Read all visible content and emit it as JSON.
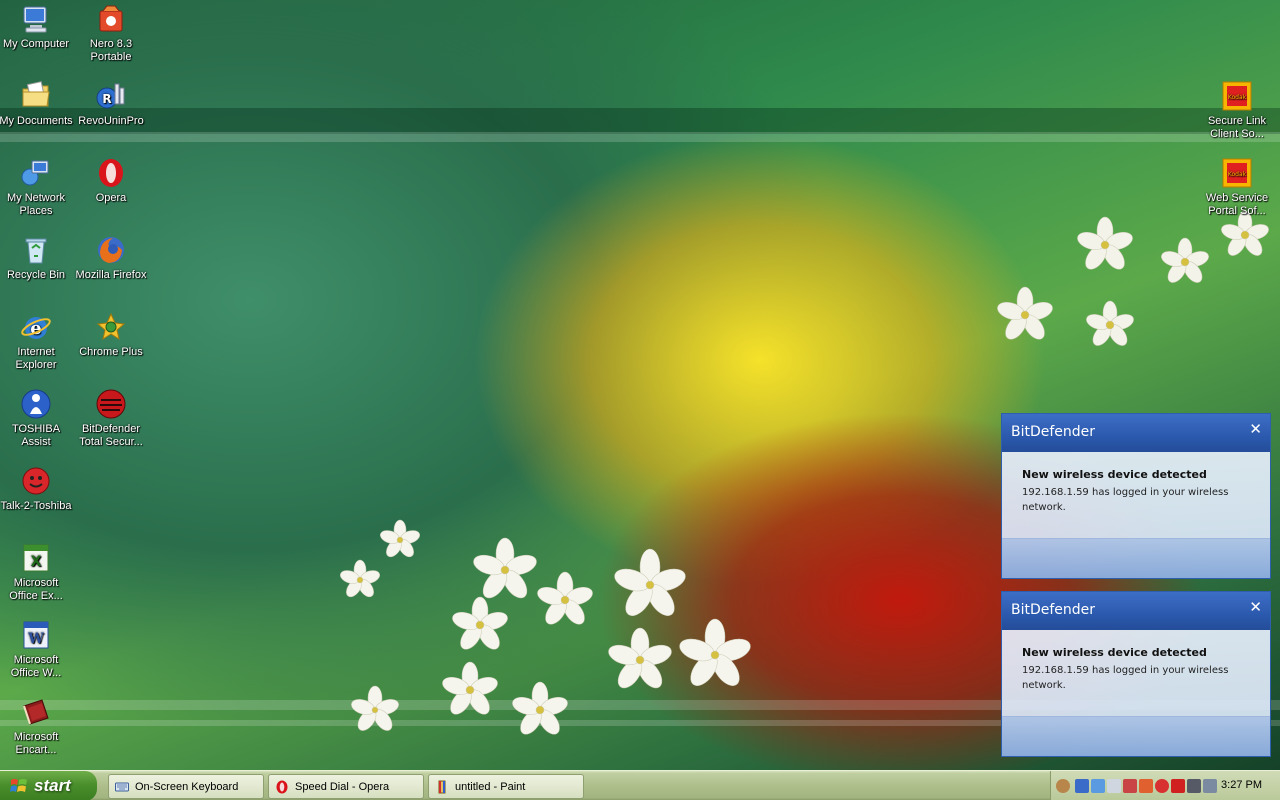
{
  "desktop": {
    "icons": [
      {
        "label": "My Computer"
      },
      {
        "label": "Nero 8.3 Portable"
      },
      {
        "label": "My Documents"
      },
      {
        "label": "RevoUninPro"
      },
      {
        "label": "My Network Places"
      },
      {
        "label": "Opera"
      },
      {
        "label": "Recycle Bin"
      },
      {
        "label": "Mozilla Firefox"
      },
      {
        "label": "Internet Explorer"
      },
      {
        "label": "Chrome Plus"
      },
      {
        "label": "TOSHIBA Assist"
      },
      {
        "label": "BitDefender Total Secur..."
      },
      {
        "label": "Talk-2-Toshiba"
      },
      {
        "label": "Microsoft Office Ex..."
      },
      {
        "label": "Microsoft Office W..."
      },
      {
        "label": "Microsoft Encart..."
      },
      {
        "label": "Secure Link Client So..."
      },
      {
        "label": "Web Service Portal Sof..."
      }
    ]
  },
  "popups": [
    {
      "title": "BitDefender",
      "close": "✕",
      "heading": "New wireless device detected",
      "body": "192.168.1.59 has logged in your wireless network."
    },
    {
      "title": "BitDefender",
      "close": "✕",
      "heading": "New wireless device detected",
      "body": "192.168.1.59 has logged in your wireless network."
    }
  ],
  "taskbar": {
    "start_label": "start",
    "tasks": [
      {
        "label": "On-Screen Keyboard"
      },
      {
        "label": "Speed Dial - Opera"
      },
      {
        "label": "untitled - Paint"
      }
    ],
    "clock": "3:27 PM"
  },
  "colors": {
    "popup_title": "#2b59ad",
    "taskbar": "#aebf8c",
    "start": "#4a8f2c"
  }
}
